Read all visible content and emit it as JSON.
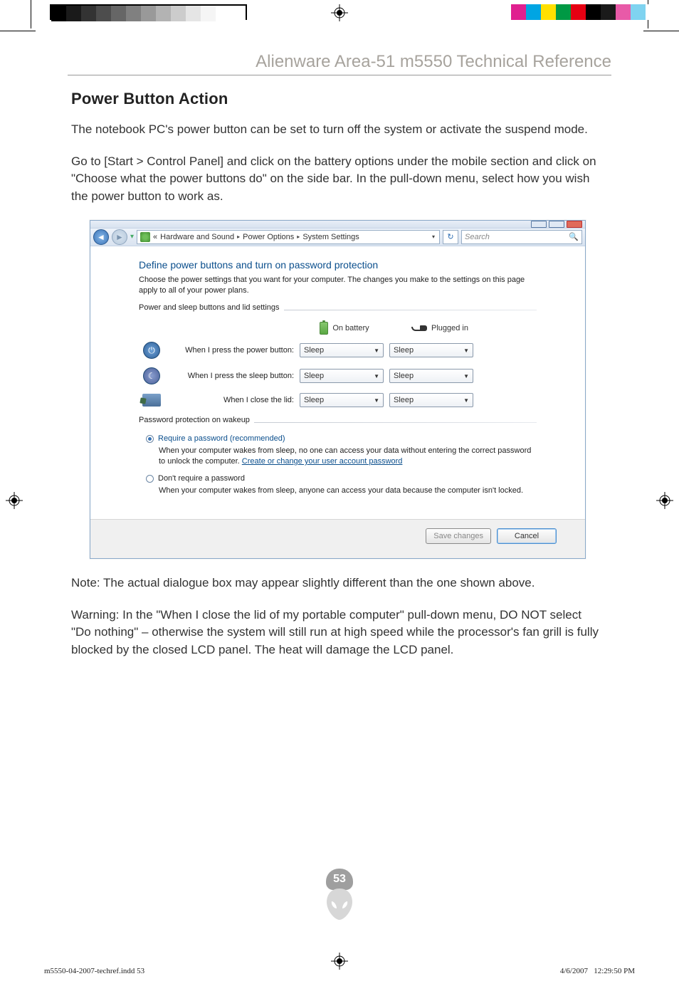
{
  "header": {
    "title": "Alienware Area-51 m5550 Technical Reference"
  },
  "section": {
    "title": "Power Button Action",
    "para1": "The notebook PC's power button can be set to turn off the system or activate the suspend mode.",
    "para2": "Go to [Start > Control Panel] and click on the battery options under the mobile section and click on \"Choose what the power buttons do\" on the side bar. In the pull-down menu, select how you wish the power button to work as.",
    "note": "Note: The actual dialogue box may appear slightly different than the one shown above.",
    "warning": "Warning: In the \"When I close the lid of my portable computer\" pull-down menu, DO NOT select \"Do nothing\" – otherwise the system will still run at high speed while the processor's fan grill is fully blocked by the closed LCD panel. The heat will damage the LCD panel."
  },
  "window": {
    "breadcrumb": {
      "prefix": "«",
      "items": [
        "Hardware and Sound",
        "Power Options",
        "System Settings"
      ]
    },
    "search_placeholder": "Search",
    "pane": {
      "title": "Define power buttons and turn on password protection",
      "subtitle": "Choose the power settings that you want for your computer. The changes you make to the settings on this page apply to all of your power plans.",
      "fieldset1": "Power and sleep buttons and lid settings",
      "col_battery": "On battery",
      "col_plugged": "Plugged in",
      "rows": [
        {
          "label": "When I press the power button:",
          "batt": "Sleep",
          "plug": "Sleep"
        },
        {
          "label": "When I press the sleep button:",
          "batt": "Sleep",
          "plug": "Sleep"
        },
        {
          "label": "When I close the lid:",
          "batt": "Sleep",
          "plug": "Sleep"
        }
      ],
      "fieldset2": "Password protection on wakeup",
      "opt1_label": "Require a password (recommended)",
      "opt1_desc_a": "When your computer wakes from sleep, no one can access your data without entering the correct password to unlock the computer. ",
      "opt1_link": "Create or change your user account password",
      "opt2_label": "Don't require a password",
      "opt2_desc": "When your computer wakes from sleep, anyone can access your data because the computer isn't locked.",
      "save_btn": "Save changes",
      "cancel_btn": "Cancel"
    }
  },
  "page_number": "53",
  "footer": {
    "left": "m5550-04-2007-techref.indd   53",
    "date": "4/6/2007",
    "time": "12:29:50 PM"
  },
  "reg_colors_left": [
    "#000000",
    "#1a1a1a",
    "#333333",
    "#4d4d4d",
    "#666666",
    "#808080",
    "#999999",
    "#b3b3b3",
    "#cccccc",
    "#e5e5e5",
    "#f5f5f5",
    "#ffffff",
    "#ffffff"
  ],
  "reg_colors_right": [
    "#ffffff",
    "#e02090",
    "#00a5e3",
    "#ffe000",
    "#009944",
    "#e60012",
    "#000000",
    "#1a1a1a",
    "#e85aa8",
    "#7fd3f0",
    "#ffffff"
  ]
}
